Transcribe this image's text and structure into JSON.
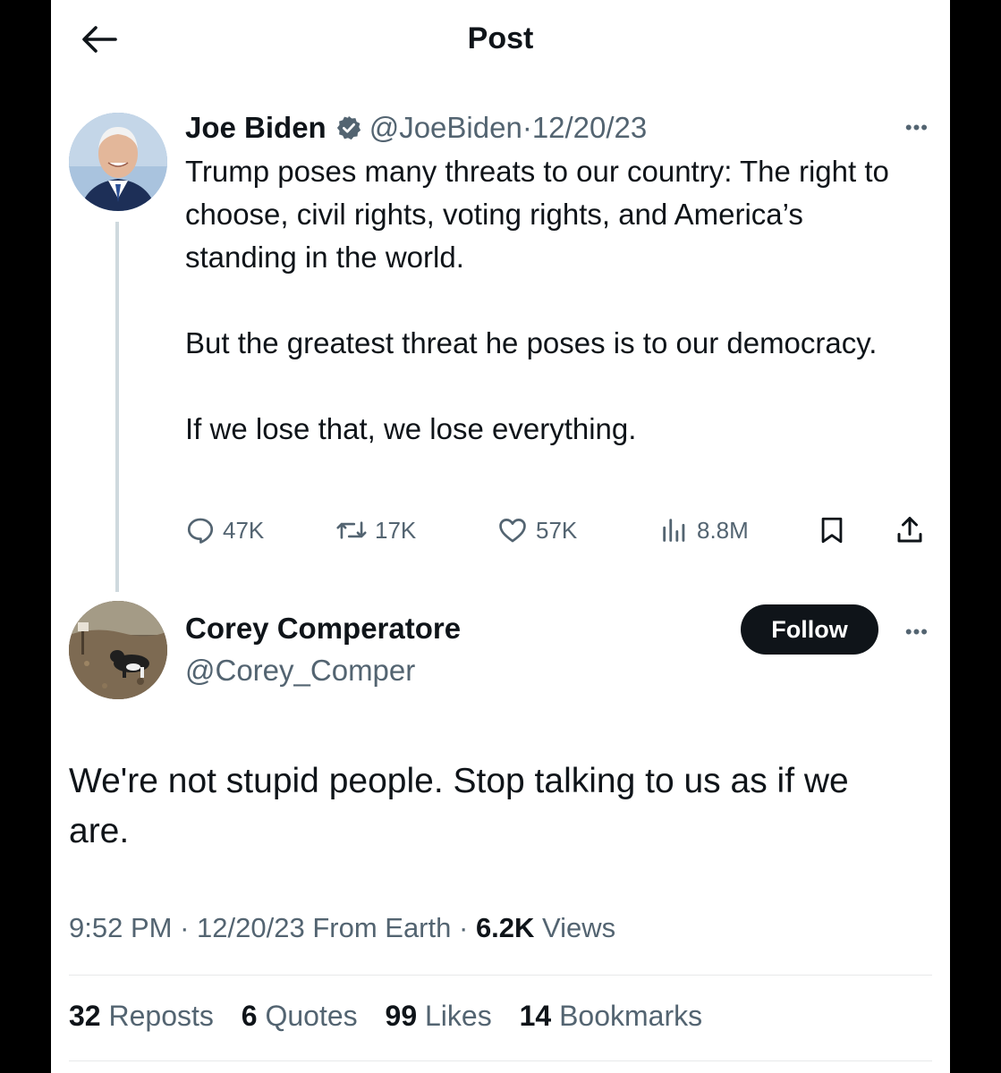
{
  "header": {
    "title": "Post",
    "back_icon": "arrow-left-icon"
  },
  "parent_tweet": {
    "author_name": "Joe Biden",
    "verified_icon": "verified-badge-icon",
    "handle": "@JoeBiden",
    "separator": "·",
    "date": "12/20/23",
    "more_icon": "more-horizontal-icon",
    "more_text": "•••",
    "text_paragraphs": [
      "Trump poses many threats to our country: The right to choose, civil rights, voting rights, and America’s standing in the world.",
      "But the greatest threat he poses is to our democracy.",
      "If we lose that, we lose everything."
    ],
    "actions": {
      "replies": "47K",
      "reposts": "17K",
      "likes": "57K",
      "views": "8.8M"
    }
  },
  "reply_tweet": {
    "author_name": "Corey Comperatore",
    "handle": "@Corey_Comper",
    "follow_label": "Follow",
    "more_text": "•••",
    "text": "We're not stupid people. Stop talking to us as if we are.",
    "time": "9:52 PM",
    "separator": "·",
    "date": "12/20/23",
    "source": "From Earth",
    "views_count": "6.2K",
    "views_label": "Views",
    "stats": {
      "reposts_count": "32",
      "reposts_label": "Reposts",
      "quotes_count": "6",
      "quotes_label": "Quotes",
      "likes_count": "99",
      "likes_label": "Likes",
      "bookmarks_count": "14",
      "bookmarks_label": "Bookmarks"
    }
  },
  "colors": {
    "text_primary": "#0f1419",
    "text_secondary": "#536471",
    "verified": "#536471",
    "divider": "#e7e9ea",
    "thread_line": "#cfd9de"
  }
}
